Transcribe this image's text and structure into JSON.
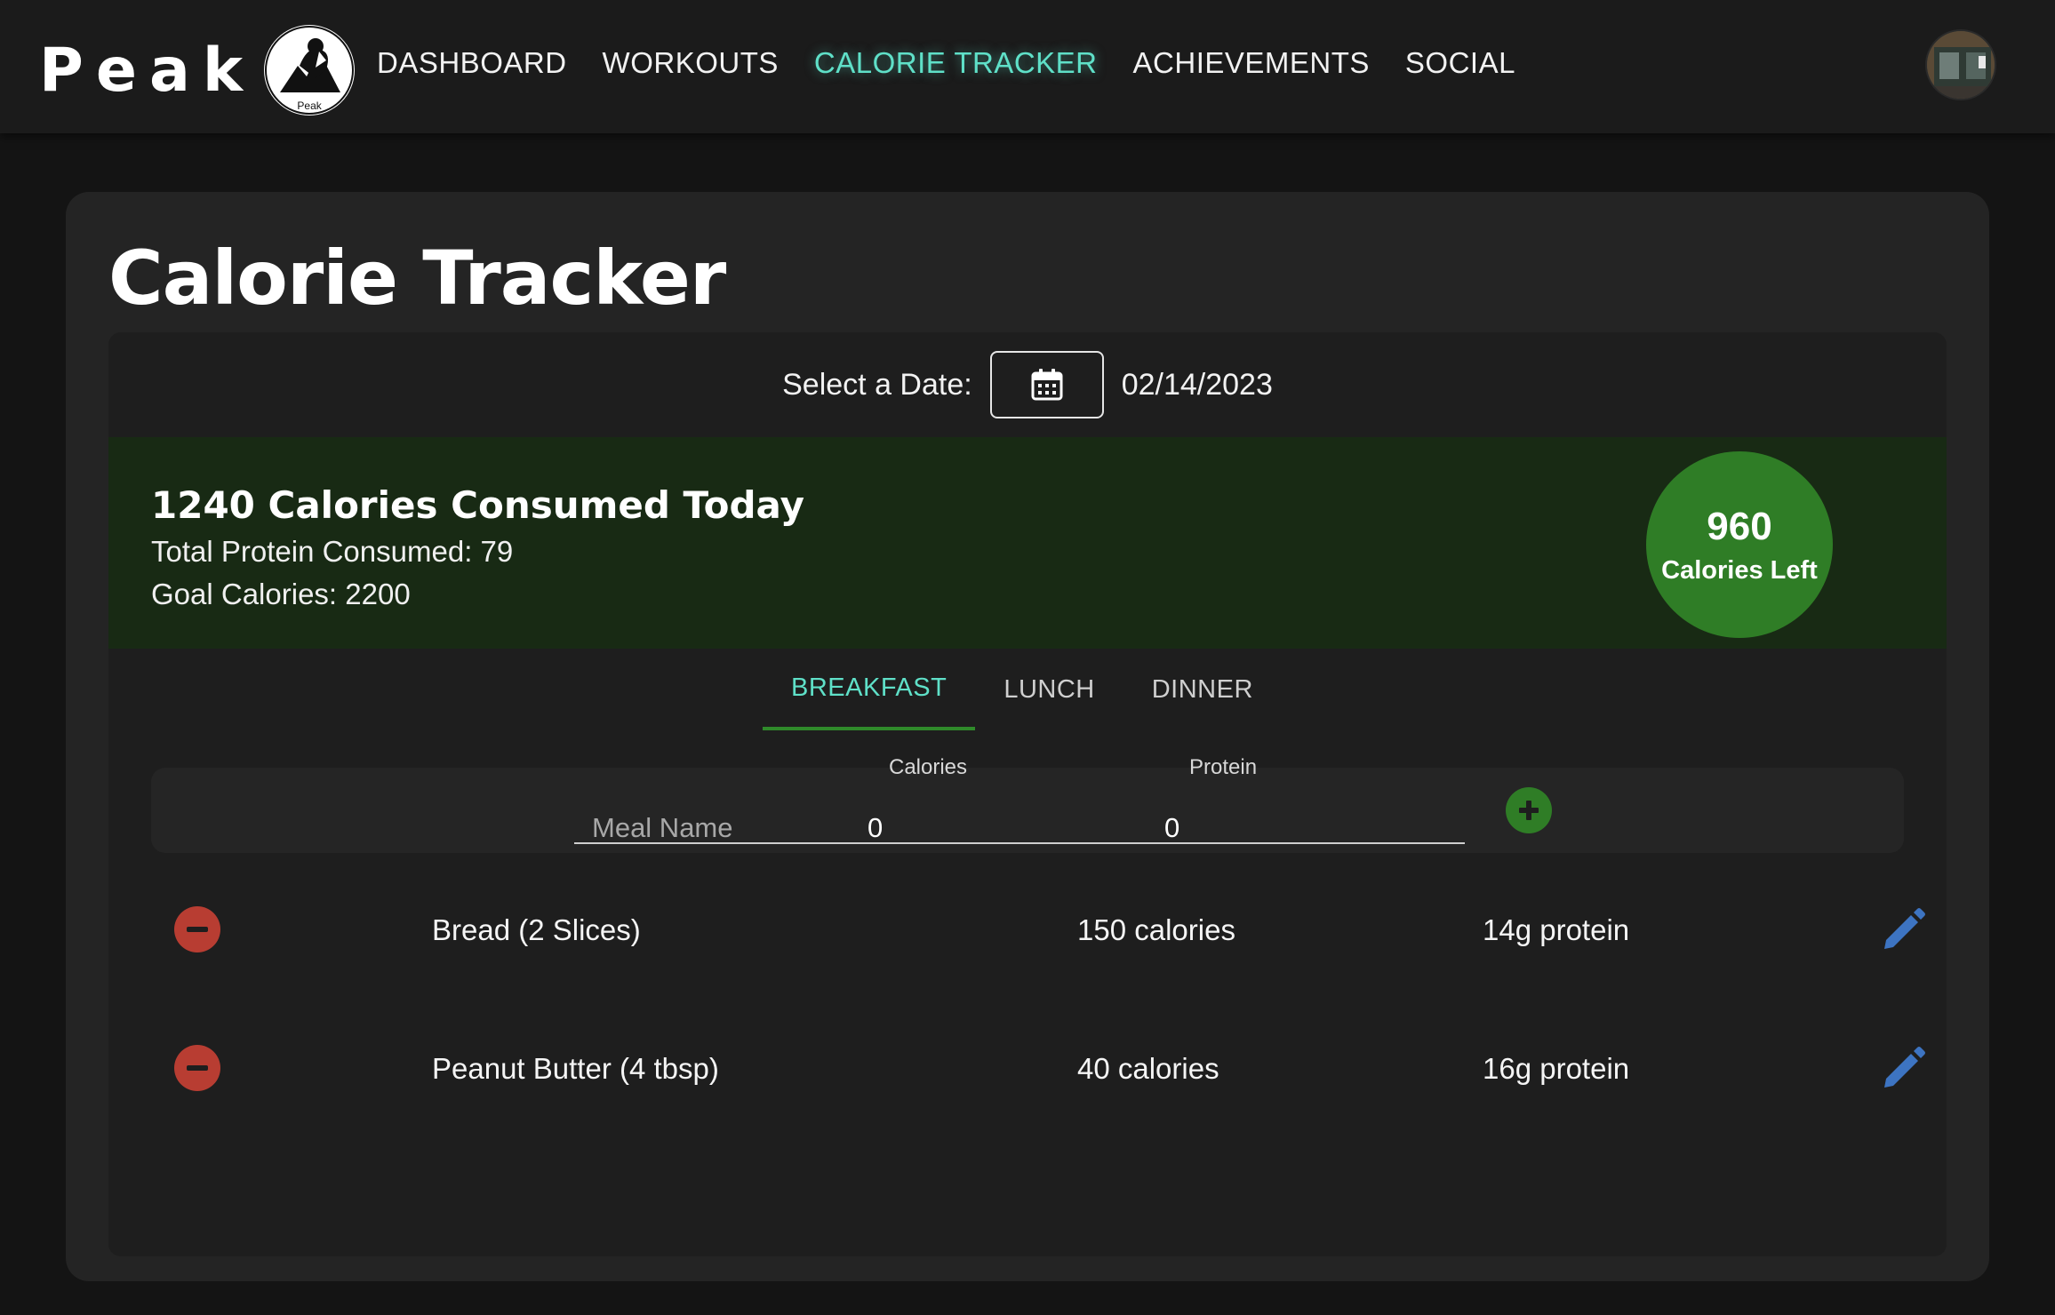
{
  "brand": {
    "name": "Peak",
    "logo_caption": "Peak"
  },
  "nav": {
    "items": [
      {
        "label": "DASHBOARD",
        "active": false
      },
      {
        "label": "WORKOUTS",
        "active": false
      },
      {
        "label": "CALORIE TRACKER",
        "active": true
      },
      {
        "label": "ACHIEVEMENTS",
        "active": false
      },
      {
        "label": "SOCIAL",
        "active": false
      }
    ],
    "accent_color": "#5fe0c8"
  },
  "page": {
    "title": "Calorie Tracker"
  },
  "date_picker": {
    "label": "Select a Date:",
    "icon": "calendar-icon",
    "value": "02/14/2023"
  },
  "summary": {
    "headline": "1240 Calories Consumed Today",
    "protein": "Total Protein Consumed: 79",
    "goal": "Goal Calories: 2200",
    "calories_left": "960",
    "calories_left_label": "Calories Left",
    "background_color": "#182a14",
    "badge_color": "#2f7d26"
  },
  "tabs": [
    {
      "label": "BREAKFAST",
      "active": true
    },
    {
      "label": "LUNCH",
      "active": false
    },
    {
      "label": "DINNER",
      "active": false
    }
  ],
  "add_form": {
    "meal_name_placeholder": "Meal Name",
    "calories_label": "Calories",
    "calories_value": "0",
    "protein_label": "Protein",
    "protein_value": "0",
    "add_icon": "plus-icon"
  },
  "meals": [
    {
      "name": "Bread (2 Slices)",
      "calories": "150 calories",
      "protein": "14g protein"
    },
    {
      "name": "Peanut Butter (4 tbsp)",
      "calories": "40 calories",
      "protein": "16g protein"
    }
  ],
  "colors": {
    "remove": "#b83d32",
    "edit": "#3d74c2",
    "add": "#2f7d26"
  }
}
